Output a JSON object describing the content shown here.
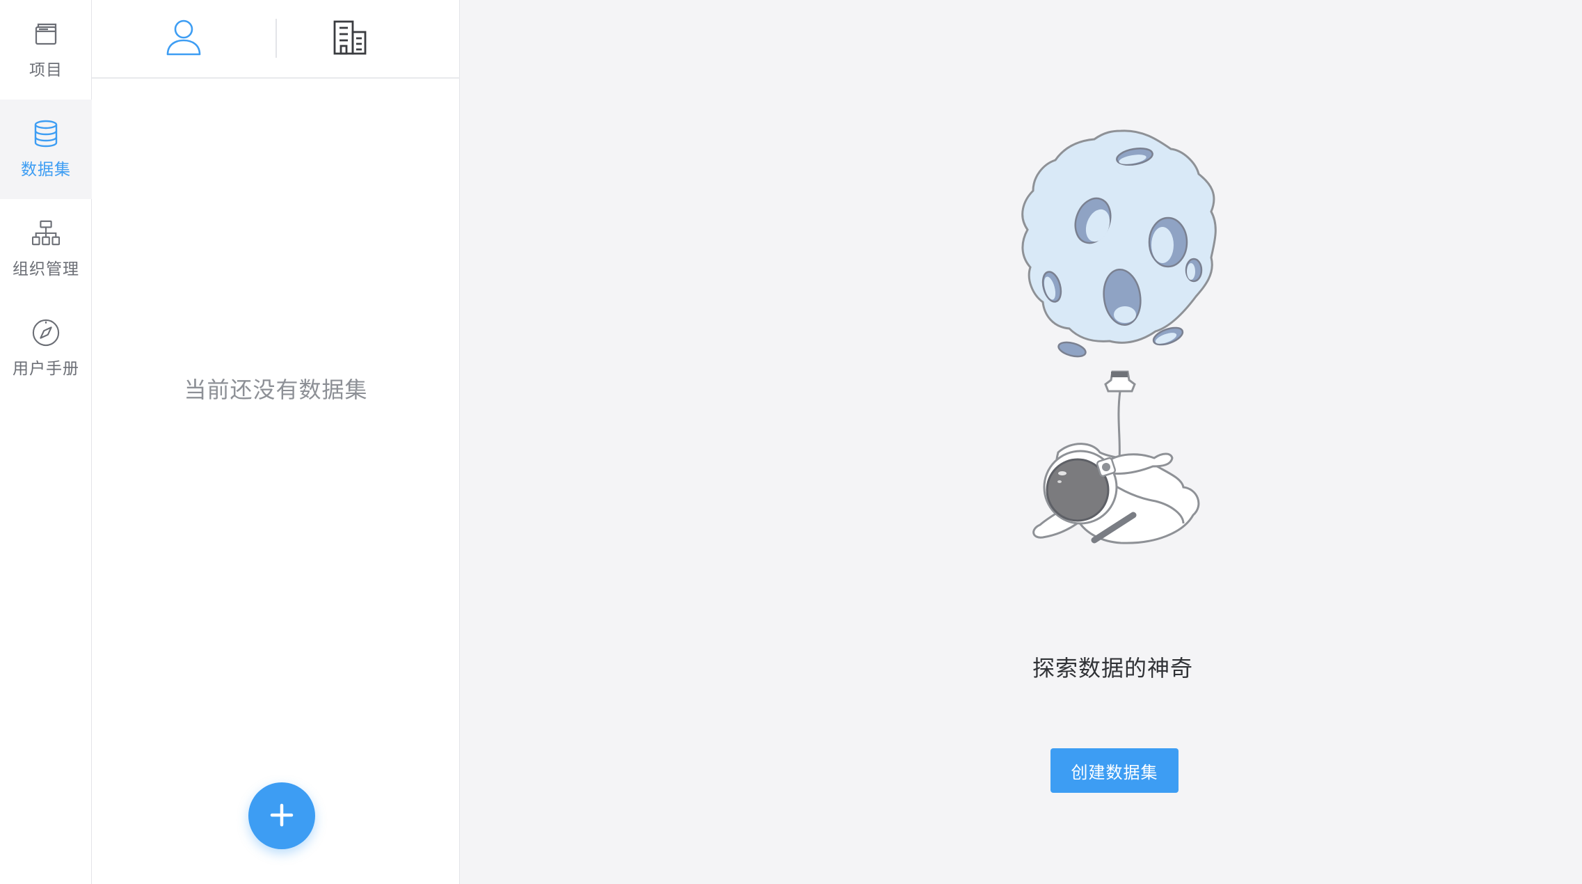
{
  "nav": {
    "items": [
      {
        "label": "项目",
        "icon": "project-window-icon",
        "active": false
      },
      {
        "label": "数据集",
        "icon": "database-icon",
        "active": true
      },
      {
        "label": "组织管理",
        "icon": "org-chart-icon",
        "active": false
      },
      {
        "label": "用户手册",
        "icon": "compass-icon",
        "active": false
      }
    ]
  },
  "panel": {
    "tabs": [
      {
        "icon": "user-icon",
        "active": true
      },
      {
        "icon": "building-icon",
        "active": false
      }
    ],
    "empty_text": "当前还没有数据集",
    "fab_icon": "plus-icon"
  },
  "main": {
    "illustration": "astronaut-balloon-illustration",
    "title": "探索数据的神奇",
    "create_button_label": "创建数据集"
  },
  "colors": {
    "accent": "#3d9df3",
    "nav_text": "#6b6e75",
    "muted_text": "#8d9096",
    "background": "#f4f4f6"
  }
}
